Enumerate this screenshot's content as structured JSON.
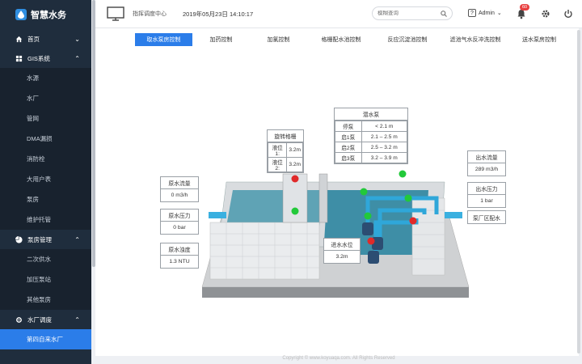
{
  "app": {
    "name": "智慧水务"
  },
  "sidebar": {
    "groups": [
      {
        "label": "首页",
        "icon": "home-icon",
        "expanded": false,
        "items": []
      },
      {
        "label": "GIS系统",
        "icon": "grid-icon",
        "expanded": true,
        "items": [
          "水源",
          "水厂",
          "管网",
          "DMA漏损",
          "消防栓",
          "大用户表",
          "泵房",
          "维护托管"
        ]
      },
      {
        "label": "泵房管理",
        "icon": "pie-icon",
        "expanded": true,
        "items": [
          "二次供水",
          "加压泵站",
          "其他泵房"
        ]
      },
      {
        "label": "水厂调度",
        "icon": "gear-icon",
        "expanded": true,
        "items": [
          "第四自来水厂"
        ]
      }
    ],
    "active_item": "第四自来水厂"
  },
  "topbar": {
    "title": "指挥调度中心",
    "datetime": "2019年05月23日 14:10:17",
    "search_placeholder": "模糊查询",
    "user": "Admin",
    "notification_count": "60"
  },
  "tabs": [
    "取水泵房控制",
    "加药控制",
    "加氯控制",
    "格栅配水池控制",
    "反应沉淀池控制",
    "滤池气水反冲洗控制",
    "送水泵房控制"
  ],
  "active_tab": "取水泵房控制",
  "panels": {
    "raw_flow": {
      "label": "原水流量",
      "value": "0 m3/h"
    },
    "raw_pressure": {
      "label": "原水压力",
      "value": "0 bar"
    },
    "raw_turbidity": {
      "label": "原水浊度",
      "value": "1.3 NTU"
    },
    "grille": {
      "label": "旋转格栅",
      "rows": [
        [
          "液位1:",
          "3.2m"
        ],
        [
          "液位2:",
          "3.2m"
        ]
      ]
    },
    "pump": {
      "label": "潜水泵",
      "rows": [
        [
          "停泵",
          "< 2.1 m"
        ],
        [
          "启1泵",
          "2.1 – 2.5 m"
        ],
        [
          "启2泵",
          "2.5 – 3.2 m"
        ],
        [
          "启3泵",
          "3.2 – 3.9 m"
        ]
      ]
    },
    "inlet_level": {
      "label": "进水水位",
      "value": "3.2m"
    },
    "out_flow": {
      "label": "出水流量",
      "value": "289 m3/h"
    },
    "out_pressure": {
      "label": "出水压力",
      "value": "1 bar"
    },
    "destination": {
      "label": "泵厂区配水"
    }
  },
  "footer": "Copyright © www.koyuaqa.com. All Rights Reserved",
  "colors": {
    "sidebar_bg": "#1f2d3d",
    "accent": "#2b7de9",
    "status_on": "#22c93a",
    "status_off": "#e02a2a",
    "pipe": "#3ab0e0"
  }
}
